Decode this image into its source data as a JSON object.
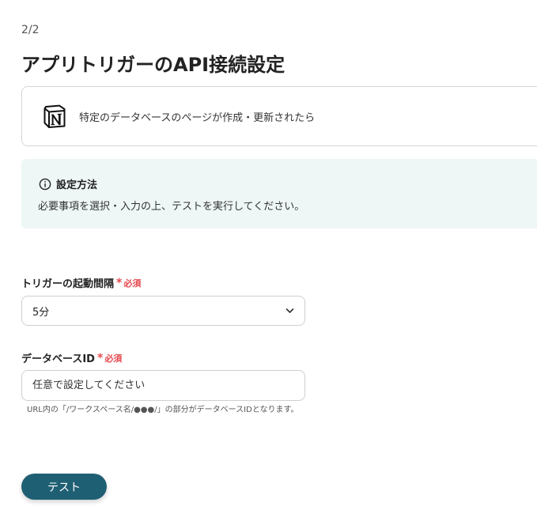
{
  "header": {
    "step": "2/2",
    "title": "アプリトリガーのAPI接続設定"
  },
  "app_card": {
    "icon": "notion-logo",
    "description": "特定のデータベースのページが作成・更新されたら"
  },
  "info": {
    "icon": "info-icon",
    "title": "設定方法",
    "body": "必要事項を選択・入力の上、テストを実行してください。"
  },
  "fields": {
    "interval": {
      "label": "トリガーの起動間隔",
      "required_mark": "*",
      "required_text": "必須",
      "value": "5分"
    },
    "database_id": {
      "label": "データベースID",
      "required_mark": "*",
      "required_text": "必須",
      "placeholder": "任意で設定してください",
      "help": "URL内の「/ワークスペース名/●●●/」の部分がデータベースIDとなります。"
    }
  },
  "actions": {
    "test_label": "テスト"
  },
  "colors": {
    "accent": "#1f5f73",
    "required": "#e5484d",
    "info_bg": "#eef7f6"
  }
}
